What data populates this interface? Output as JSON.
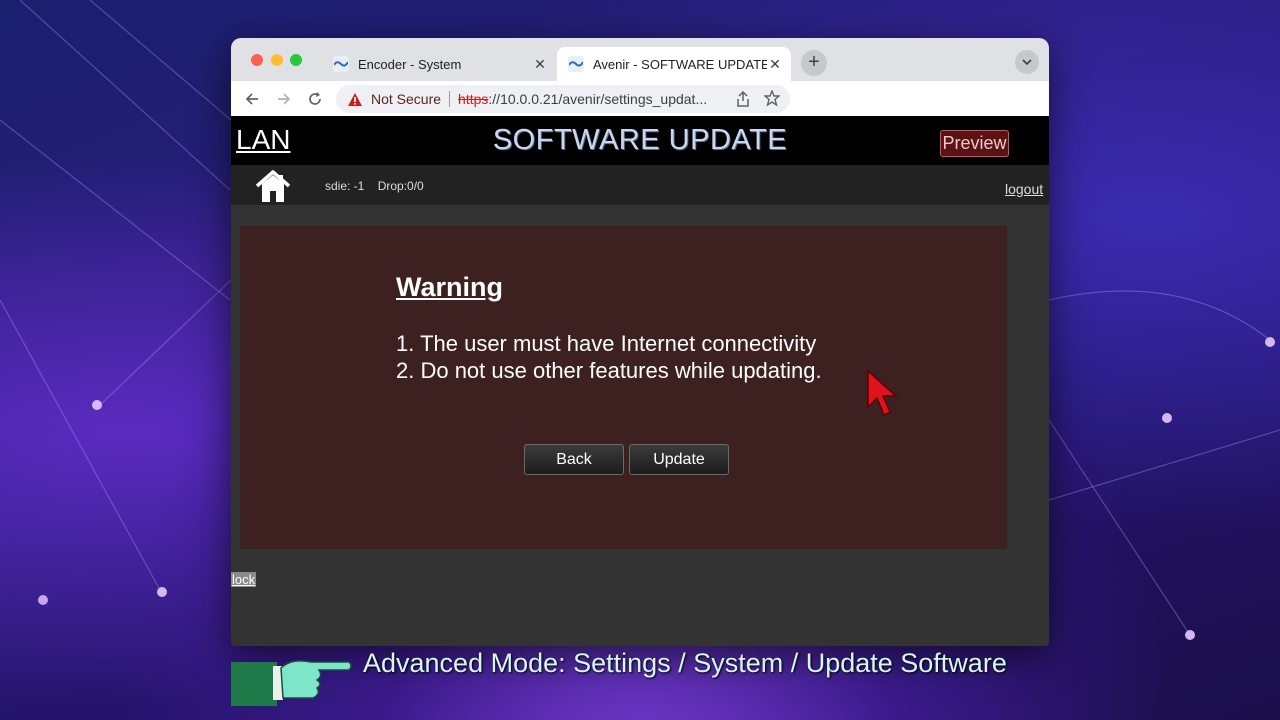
{
  "browser": {
    "tabs": [
      {
        "title": "Encoder - System",
        "active": false
      },
      {
        "title": "Avenir - SOFTWARE UPDATE",
        "active": true
      }
    ],
    "address": {
      "security_label": "Not Secure",
      "scheme": "https",
      "rest": "://10.0.0.21/avenir/settings_updat..."
    }
  },
  "header": {
    "lan_label": "LAN",
    "title": "SOFTWARE UPDATE",
    "preview_label": "Preview"
  },
  "subbar": {
    "sdie": "sdie: -1",
    "drop": "Drop:0/0",
    "logout_label": "logout"
  },
  "warning": {
    "heading": "Warning",
    "items": [
      "1. The user must have Internet connectivity",
      "2. Do not use other features while updating."
    ],
    "back_label": "Back",
    "update_label": "Update"
  },
  "footer": {
    "lock_label": "lock"
  },
  "caption": {
    "text": "Advanced Mode: Settings / System / Update Software"
  },
  "colors": {
    "page_bg": "#333333",
    "header_bg": "#000000",
    "panel_bg": "#3d2020",
    "preview_bg": "#5a1214",
    "cursor": "#e0121c",
    "caption_text": "#d4f7f0"
  },
  "icons": [
    "close-icon",
    "new-tab-icon",
    "tab-menu-icon",
    "back-arrow-icon",
    "forward-arrow-icon",
    "reload-icon",
    "warning-icon",
    "share-icon",
    "star-icon",
    "home-icon",
    "mouse-cursor-icon",
    "pointing-hand-icon"
  ]
}
